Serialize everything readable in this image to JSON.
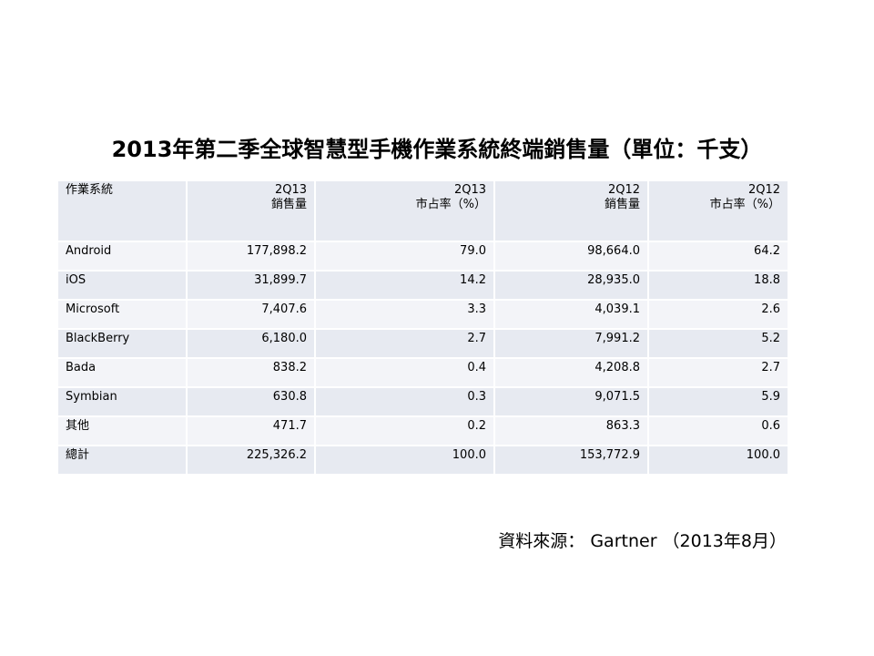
{
  "title": "2013年第二季全球智慧型手機作業系統終端銷售量（單位：千支）",
  "headers": {
    "os": "作業系統",
    "q213_units_line1": "2Q13",
    "q213_units_line2": "銷售量",
    "q213_share_line1": "2Q13",
    "q213_share_line2": "市占率（%）",
    "q212_units_line1": "2Q12",
    "q212_units_line2": "銷售量",
    "q212_share_line1": "2Q12",
    "q212_share_line2": "市占率（%）"
  },
  "rows": [
    {
      "os": "Android",
      "u13": "177,898.2",
      "s13": "79.0",
      "u12": "98,664.0",
      "s12": "64.2"
    },
    {
      "os": "iOS",
      "u13": "31,899.7",
      "s13": "14.2",
      "u12": "28,935.0",
      "s12": "18.8"
    },
    {
      "os": "Microsoft",
      "u13": "7,407.6",
      "s13": "3.3",
      "u12": "4,039.1",
      "s12": "2.6"
    },
    {
      "os": "BlackBerry",
      "u13": "6,180.0",
      "s13": "2.7",
      "u12": "7,991.2",
      "s12": "5.2"
    },
    {
      "os": "Bada",
      "u13": "838.2",
      "s13": "0.4",
      "u12": "4,208.8",
      "s12": "2.7"
    },
    {
      "os": "Symbian",
      "u13": "630.8",
      "s13": "0.3",
      "u12": "9,071.5",
      "s12": "5.9"
    },
    {
      "os": "其他",
      "u13": "471.7",
      "s13": "0.2",
      "u12": "863.3",
      "s12": "0.6"
    },
    {
      "os": "總計",
      "u13": "225,326.2",
      "s13": "100.0",
      "u12": "153,772.9",
      "s12": "100.0"
    }
  ],
  "source": "資料來源： Gartner （2013年8月）",
  "colors": {
    "row_odd": "#e7eaf1",
    "row_even": "#f3f4f8"
  }
}
